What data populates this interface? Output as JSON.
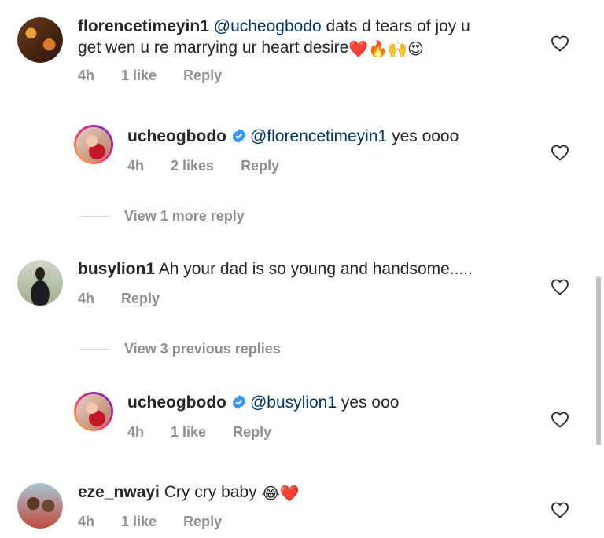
{
  "comments": [
    {
      "username": "florencetimeyin1",
      "mention": "@ucheogbodo",
      "text": "dats d tears of joy u",
      "text2": "get wen u re marrying ur heart desire",
      "emojis": "❤️🔥🙌😍",
      "time": "4h",
      "likes": "1 like",
      "reply": "Reply"
    },
    {
      "username": "ucheogbodo",
      "mention": "@florencetimeyin1",
      "text": "yes oooo",
      "time": "4h",
      "likes": "2 likes",
      "reply": "Reply"
    },
    {
      "view_more": "View 1 more reply"
    },
    {
      "username": "busylion1",
      "text": "Ah your dad is so young and handsome.....",
      "time": "4h",
      "reply": "Reply"
    },
    {
      "view_more": "View 3 previous replies"
    },
    {
      "username": "ucheogbodo",
      "mention": "@busylion1",
      "text": "yes ooo",
      "time": "4h",
      "likes": "1 like",
      "reply": "Reply"
    },
    {
      "username": "eze_nwayi",
      "text": "Cry cry baby",
      "emojis": "😂❤️",
      "time": "4h",
      "likes": "1 like",
      "reply": "Reply"
    }
  ]
}
